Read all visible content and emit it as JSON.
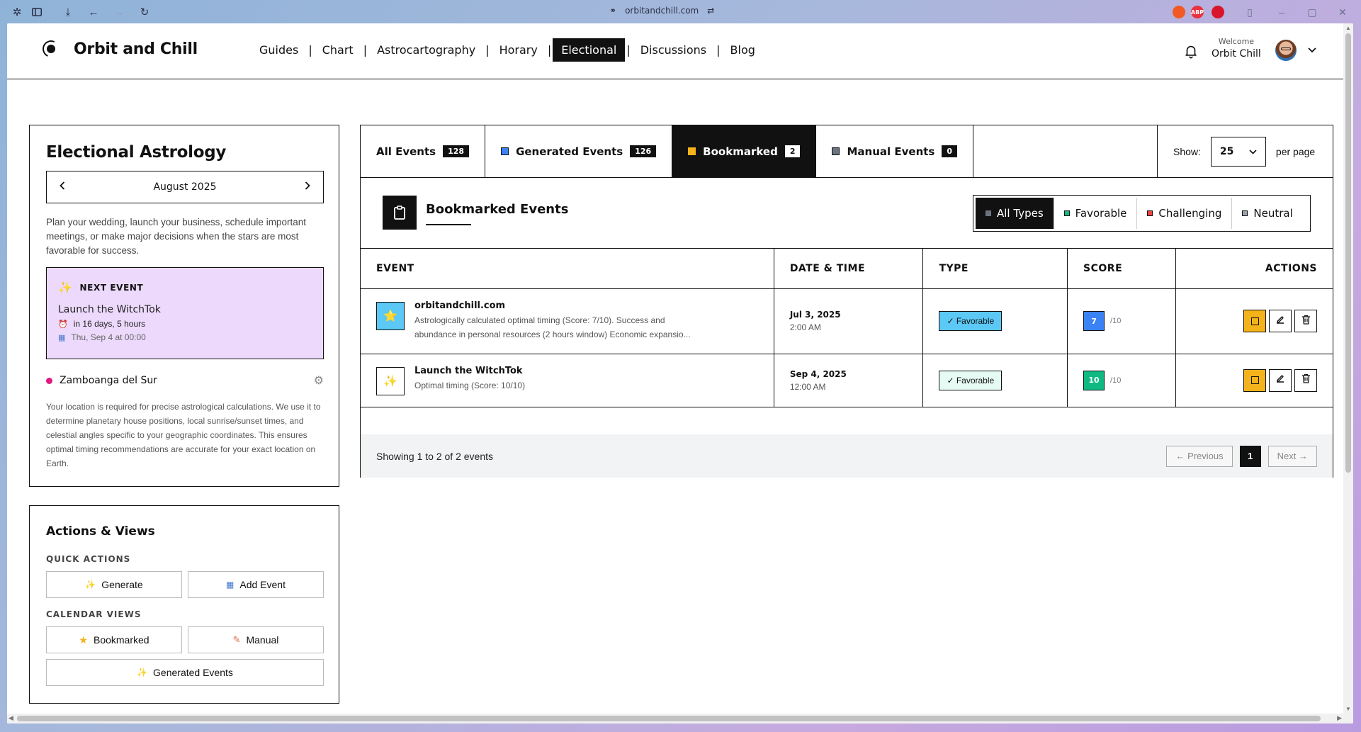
{
  "browser": {
    "url": "orbitandchill.com",
    "extensions": [
      {
        "name": "extension-a-icon",
        "color": "#f15a24",
        "text": ""
      },
      {
        "name": "adblock-icon",
        "color": "#e8323c",
        "text": "ABP"
      },
      {
        "name": "extension-b-icon",
        "color": "#d8152b",
        "text": ""
      }
    ]
  },
  "header": {
    "site_title": "Orbit and Chill",
    "nav": [
      "Guides",
      "Chart",
      "Astrocartography",
      "Horary",
      "Electional",
      "Discussions",
      "Blog"
    ],
    "active_nav": "Electional",
    "welcome_label": "Welcome",
    "user_name": "Orbit Chill"
  },
  "sidebar": {
    "title": "Electional Astrology",
    "month": "August 2025",
    "description": "Plan your wedding, launch your business, schedule important meetings, or make major decisions when the stars are most favorable for success.",
    "next_event": {
      "heading": "NEXT EVENT",
      "title": "Launch the WitchTok",
      "countdown_prefix": "in ",
      "countdown": "16 days, 5 hours",
      "date": "Thu, Sep 4 at 00:00"
    },
    "location": {
      "name": "Zamboanga del Sur",
      "description": "Your location is required for precise astrological calculations. We use it to determine planetary house positions, local sunrise/sunset times, and celestial angles specific to your geographic coordinates. This ensures optimal timing recommendations are accurate for your exact location on Earth."
    }
  },
  "actions_panel": {
    "title": "Actions & Views",
    "quick_label": "QUICK ACTIONS",
    "generate": "Generate",
    "add_event": "Add Event",
    "calendar_label": "CALENDAR VIEWS",
    "bookmarked": "Bookmarked",
    "manual": "Manual",
    "generated_events": "Generated Events"
  },
  "tabs": [
    {
      "label": "All Events",
      "count": "128",
      "color": ""
    },
    {
      "label": "Generated Events",
      "count": "126",
      "color": "#3b82f6"
    },
    {
      "label": "Bookmarked",
      "count": "2",
      "color": "#f4b21b"
    },
    {
      "label": "Manual Events",
      "count": "0",
      "color": "#6b7280"
    }
  ],
  "active_tab": "Bookmarked",
  "per_page": {
    "show_label": "Show:",
    "value": "25",
    "suffix": "per page"
  },
  "section": {
    "title": "Bookmarked Events",
    "filters": [
      {
        "label": "All Types",
        "color": "#6b7280"
      },
      {
        "label": "Favorable",
        "color": "#10b981"
      },
      {
        "label": "Challenging",
        "color": "#ef4444"
      },
      {
        "label": "Neutral",
        "color": "#9ca3af"
      }
    ],
    "active_filter": "All Types"
  },
  "table": {
    "columns": [
      "EVENT",
      "DATE & TIME",
      "TYPE",
      "SCORE",
      "ACTIONS"
    ],
    "rows": [
      {
        "icon": "⭐",
        "icon_bg": "#5bc8f5",
        "name": "orbitandchill.com",
        "description": "Astrologically calculated optimal timing (Score: 7/10). Success and abundance in personal resources (2 hours window) Economic expansio...",
        "date": "Jul 3, 2025",
        "time": "2:00 AM",
        "type": "✓ Favorable",
        "type_bg": "#5bc8f5",
        "score": "7",
        "score_of": "/10",
        "score_bg": "#3b82f6"
      },
      {
        "icon": "✨",
        "icon_bg": "#ffffff",
        "name": "Launch the WitchTok",
        "description": "Optimal timing (Score: 10/10)",
        "date": "Sep 4, 2025",
        "time": "12:00 AM",
        "type": "✓ Favorable",
        "type_bg": "#e6fbf3",
        "score": "10",
        "score_of": "/10",
        "score_bg": "#10b981"
      }
    ]
  },
  "pagination": {
    "info": "Showing 1 to 2 of 2 events",
    "prev": "← Previous",
    "current": "1",
    "next": "Next →"
  }
}
